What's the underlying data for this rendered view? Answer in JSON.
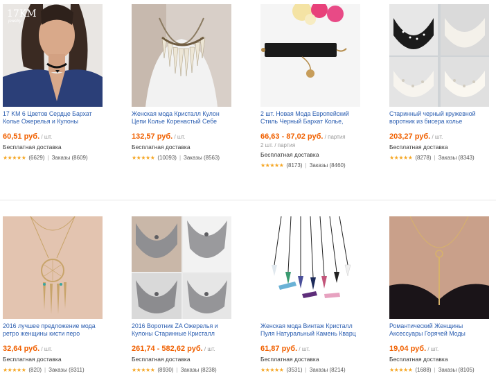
{
  "products": [
    {
      "title": "17 KM 6 Цветов Сердце Бархат Колье Ожерелья и Кулоны",
      "price": "60,51 руб.",
      "unit": "/ шт.",
      "extra_unit": "",
      "shipping": "Бесплатная доставка",
      "stars": "★★★★★",
      "reviews": "(6629)",
      "orders": "Заказы (8609)",
      "image": "woman-choker",
      "brand": "17KM",
      "brand_sub": "jewelry"
    },
    {
      "title": "Женская мода Кристалл Кулон Цепи Колье Коренастый Себе",
      "price": "132,57 руб.",
      "unit": "/ шт.",
      "extra_unit": "",
      "shipping": "Бесплатная доставка",
      "stars": "★★★★★",
      "reviews": "(10093)",
      "orders": "Заказы (8563)",
      "image": "spike-necklace"
    },
    {
      "title": "2 шт. Новая Мода Европейский Стиль Черный Бархат Колье,",
      "price": "66,63 - 87,02 руб.",
      "unit": "/ партия",
      "extra_unit": "2 шт. / партия",
      "shipping": "Бесплатная доставка",
      "stars": "★★★★★",
      "reviews": "(8173)",
      "orders": "Заказы (8460)",
      "image": "velvet-choker"
    },
    {
      "title": "Старинный черный кружевной воротник из бисера колье",
      "price": "203,27 руб.",
      "unit": "/ шт.",
      "extra_unit": "",
      "shipping": "Бесплатная доставка",
      "stars": "★★★★★",
      "reviews": "(8278)",
      "orders": "Заказы (8343)",
      "image": "pearl-collar"
    },
    {
      "title": "2016 лучшее предложение мода ретро женщины кисти перо",
      "price": "32,64 руб.",
      "unit": "/ шт.",
      "extra_unit": "",
      "shipping": "Бесплатная доставка",
      "stars": "★★★★★",
      "reviews": "(820)",
      "orders": "Заказы (8311)",
      "image": "dreamcatcher"
    },
    {
      "title": "2016 Воротник ZA Ожерелья и Кулоны Старинные Кристалл",
      "price": "261,74 - 582,62 руб.",
      "unit": "/ шт.",
      "extra_unit": "",
      "shipping": "Бесплатная доставка",
      "stars": "★★★★★",
      "reviews": "(8930)",
      "orders": "Заказы (8238)",
      "image": "statement-collage"
    },
    {
      "title": "Женская мода Винтаж Кристалл Пуля Натуральный Камень Кварц",
      "price": "61,87 руб.",
      "unit": "/ шт.",
      "extra_unit": "",
      "shipping": "Бесплатная доставка",
      "stars": "★★★★★",
      "reviews": "(3531)",
      "orders": "Заказы (8214)",
      "image": "crystal-pendants"
    },
    {
      "title": "Романтический Женщины Аксессуары Горячей Моды",
      "price": "19,04 руб.",
      "unit": "/ шт.",
      "extra_unit": "",
      "shipping": "Бесплатная доставка",
      "stars": "★★★★★",
      "reviews": "(1688)",
      "orders": "Заказы (8105)",
      "image": "lariat-necklace"
    }
  ]
}
